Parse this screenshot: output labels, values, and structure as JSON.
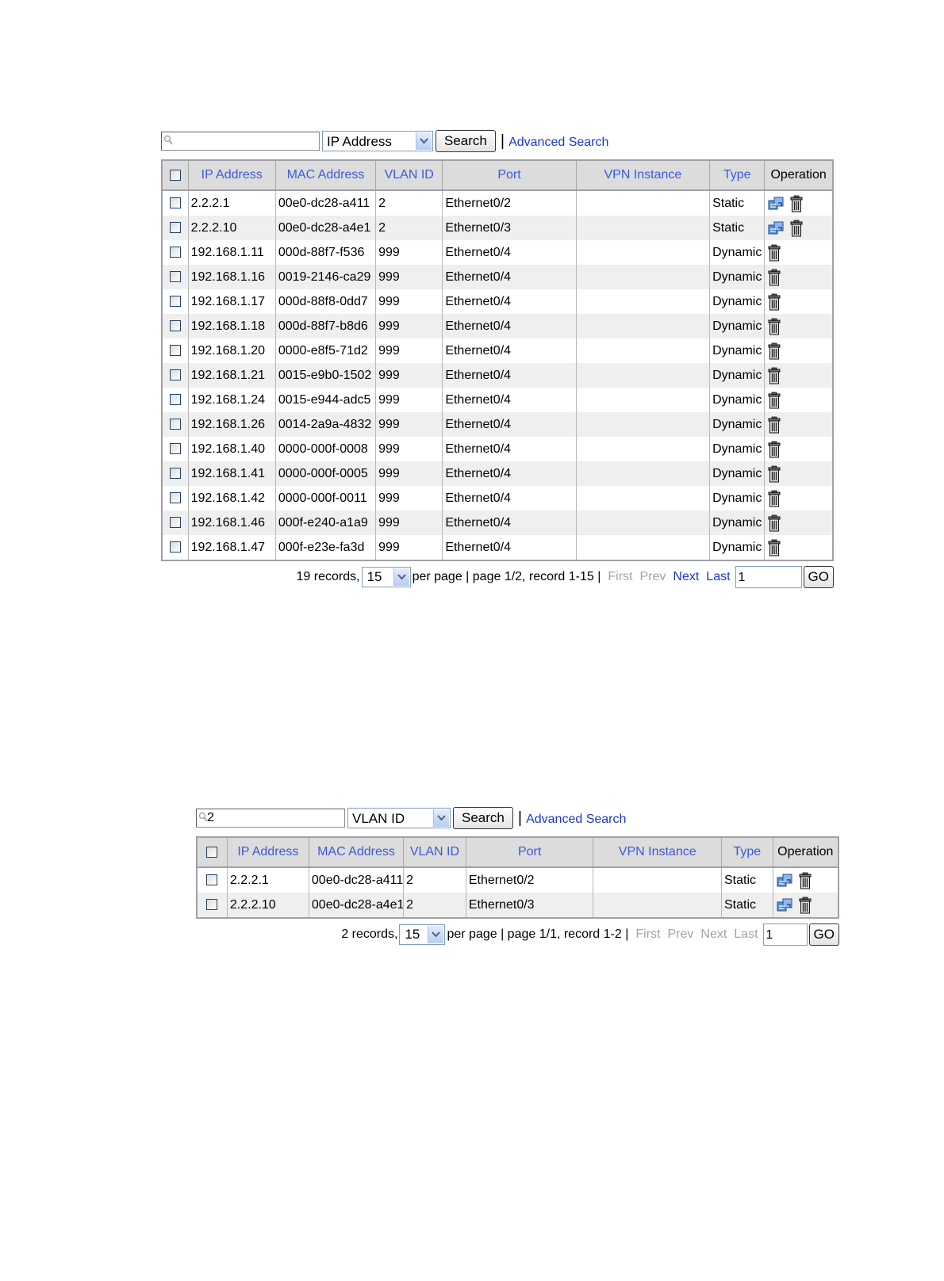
{
  "panels": [
    {
      "search": {
        "value": "",
        "field": "IP Address",
        "button": "Search",
        "separator": "|",
        "advanced": "Advanced Search"
      },
      "columns": [
        "IP Address",
        "MAC Address",
        "VLAN ID",
        "Port",
        "VPN Instance",
        "Type",
        "Operation"
      ],
      "rows": [
        {
          "ip": "2.2.2.1",
          "mac": "00e0-dc28-a411",
          "vlan": "2",
          "port": "Ethernet0/2",
          "vpn": "",
          "type": "Static",
          "ops": [
            "configure-icon",
            "delete-icon"
          ]
        },
        {
          "ip": "2.2.2.10",
          "mac": "00e0-dc28-a4e1",
          "vlan": "2",
          "port": "Ethernet0/3",
          "vpn": "",
          "type": "Static",
          "ops": [
            "configure-icon",
            "delete-icon"
          ]
        },
        {
          "ip": "192.168.1.11",
          "mac": "000d-88f7-f536",
          "vlan": "999",
          "port": "Ethernet0/4",
          "vpn": "",
          "type": "Dynamic",
          "ops": [
            "delete-icon"
          ]
        },
        {
          "ip": "192.168.1.16",
          "mac": "0019-2146-ca29",
          "vlan": "999",
          "port": "Ethernet0/4",
          "vpn": "",
          "type": "Dynamic",
          "ops": [
            "delete-icon"
          ]
        },
        {
          "ip": "192.168.1.17",
          "mac": "000d-88f8-0dd7",
          "vlan": "999",
          "port": "Ethernet0/4",
          "vpn": "",
          "type": "Dynamic",
          "ops": [
            "delete-icon"
          ]
        },
        {
          "ip": "192.168.1.18",
          "mac": "000d-88f7-b8d6",
          "vlan": "999",
          "port": "Ethernet0/4",
          "vpn": "",
          "type": "Dynamic",
          "ops": [
            "delete-icon"
          ]
        },
        {
          "ip": "192.168.1.20",
          "mac": "0000-e8f5-71d2",
          "vlan": "999",
          "port": "Ethernet0/4",
          "vpn": "",
          "type": "Dynamic",
          "ops": [
            "delete-icon"
          ]
        },
        {
          "ip": "192.168.1.21",
          "mac": "0015-e9b0-1502",
          "vlan": "999",
          "port": "Ethernet0/4",
          "vpn": "",
          "type": "Dynamic",
          "ops": [
            "delete-icon"
          ]
        },
        {
          "ip": "192.168.1.24",
          "mac": "0015-e944-adc5",
          "vlan": "999",
          "port": "Ethernet0/4",
          "vpn": "",
          "type": "Dynamic",
          "ops": [
            "delete-icon"
          ]
        },
        {
          "ip": "192.168.1.26",
          "mac": "0014-2a9a-4832",
          "vlan": "999",
          "port": "Ethernet0/4",
          "vpn": "",
          "type": "Dynamic",
          "ops": [
            "delete-icon"
          ]
        },
        {
          "ip": "192.168.1.40",
          "mac": "0000-000f-0008",
          "vlan": "999",
          "port": "Ethernet0/4",
          "vpn": "",
          "type": "Dynamic",
          "ops": [
            "delete-icon"
          ]
        },
        {
          "ip": "192.168.1.41",
          "mac": "0000-000f-0005",
          "vlan": "999",
          "port": "Ethernet0/4",
          "vpn": "",
          "type": "Dynamic",
          "ops": [
            "delete-icon"
          ]
        },
        {
          "ip": "192.168.1.42",
          "mac": "0000-000f-0011",
          "vlan": "999",
          "port": "Ethernet0/4",
          "vpn": "",
          "type": "Dynamic",
          "ops": [
            "delete-icon"
          ]
        },
        {
          "ip": "192.168.1.46",
          "mac": "000f-e240-a1a9",
          "vlan": "999",
          "port": "Ethernet0/4",
          "vpn": "",
          "type": "Dynamic",
          "ops": [
            "delete-icon"
          ]
        },
        {
          "ip": "192.168.1.47",
          "mac": "000f-e23e-fa3d",
          "vlan": "999",
          "port": "Ethernet0/4",
          "vpn": "",
          "type": "Dynamic",
          "ops": [
            "delete-icon"
          ]
        }
      ],
      "pager": {
        "records": "19 records,",
        "per_page_value": "15",
        "info": "per page | page 1/2, record 1-15 |",
        "first": "First",
        "prev": "Prev",
        "next": "Next",
        "last": "Last",
        "page_value": "1",
        "go": "GO"
      }
    },
    {
      "search": {
        "value": "2",
        "field": "VLAN ID",
        "button": "Search",
        "separator": "|",
        "advanced": "Advanced Search"
      },
      "columns": [
        "IP Address",
        "MAC Address",
        "VLAN ID",
        "Port",
        "VPN Instance",
        "Type",
        "Operation"
      ],
      "rows": [
        {
          "ip": "2.2.2.1",
          "mac": "00e0-dc28-a411",
          "vlan": "2",
          "port": "Ethernet0/2",
          "vpn": "",
          "type": "Static",
          "ops": [
            "configure-icon",
            "delete-icon"
          ]
        },
        {
          "ip": "2.2.2.10",
          "mac": "00e0-dc28-a4e1",
          "vlan": "2",
          "port": "Ethernet0/3",
          "vpn": "",
          "type": "Static",
          "ops": [
            "configure-icon",
            "delete-icon"
          ]
        }
      ],
      "pager": {
        "records": "2 records,",
        "per_page_value": "15",
        "info": "per page | page 1/1, record 1-2 |",
        "first": "First",
        "prev": "Prev",
        "next": "Next",
        "last": "Last",
        "page_value": "1",
        "go": "GO"
      }
    }
  ],
  "colors": {
    "header_link": "#3c5ad8",
    "link": "#1d38c9",
    "disabled": "#a3a3a3",
    "header_bg": "#dcdcdc",
    "alt_row": "#efefef"
  }
}
